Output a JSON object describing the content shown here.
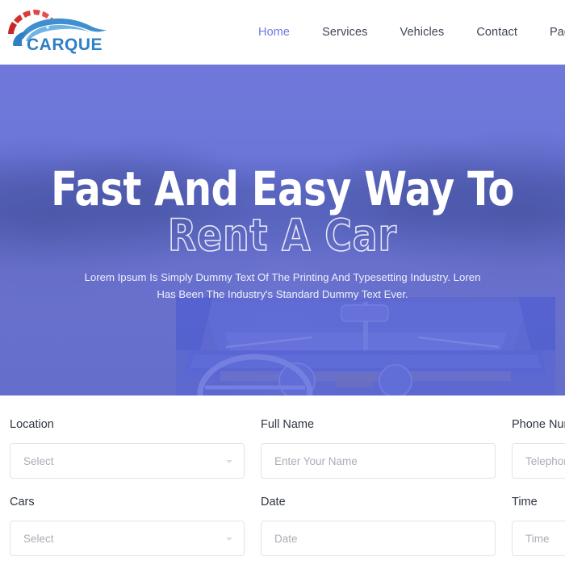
{
  "header": {
    "logo": {
      "text": "CARQUE",
      "accent_red": "#d02a2a",
      "accent_blue": "#2f7fc4"
    },
    "nav": [
      {
        "label": "Home",
        "active": true
      },
      {
        "label": "Services",
        "active": false
      },
      {
        "label": "Vehicles",
        "active": false
      },
      {
        "label": "Contact",
        "active": false
      },
      {
        "label": "Page",
        "active": false
      }
    ]
  },
  "hero": {
    "title_line1": "Fast And Easy Way To",
    "title_line2": "Rent A Car",
    "subtitle_line1": "Lorem Ipsum Is Simply Dummy Text Of The Printing And Typesetting Industry. Loren",
    "subtitle_line2": "Has Been The Industry's Standard Dummy Text Ever.",
    "overlay_color": "#565ED6"
  },
  "booking_form": {
    "fields": [
      {
        "label": "Location",
        "placeholder": "Select",
        "type": "select"
      },
      {
        "label": "Full Name",
        "placeholder": "Enter Your Name",
        "type": "text"
      },
      {
        "label": "Phone Numb",
        "placeholder": "Telephone",
        "type": "text"
      },
      {
        "label": "Cars",
        "placeholder": "Select",
        "type": "select"
      },
      {
        "label": "Date",
        "placeholder": "Date",
        "type": "text"
      },
      {
        "label": "Time",
        "placeholder": "Time",
        "type": "text"
      }
    ]
  }
}
